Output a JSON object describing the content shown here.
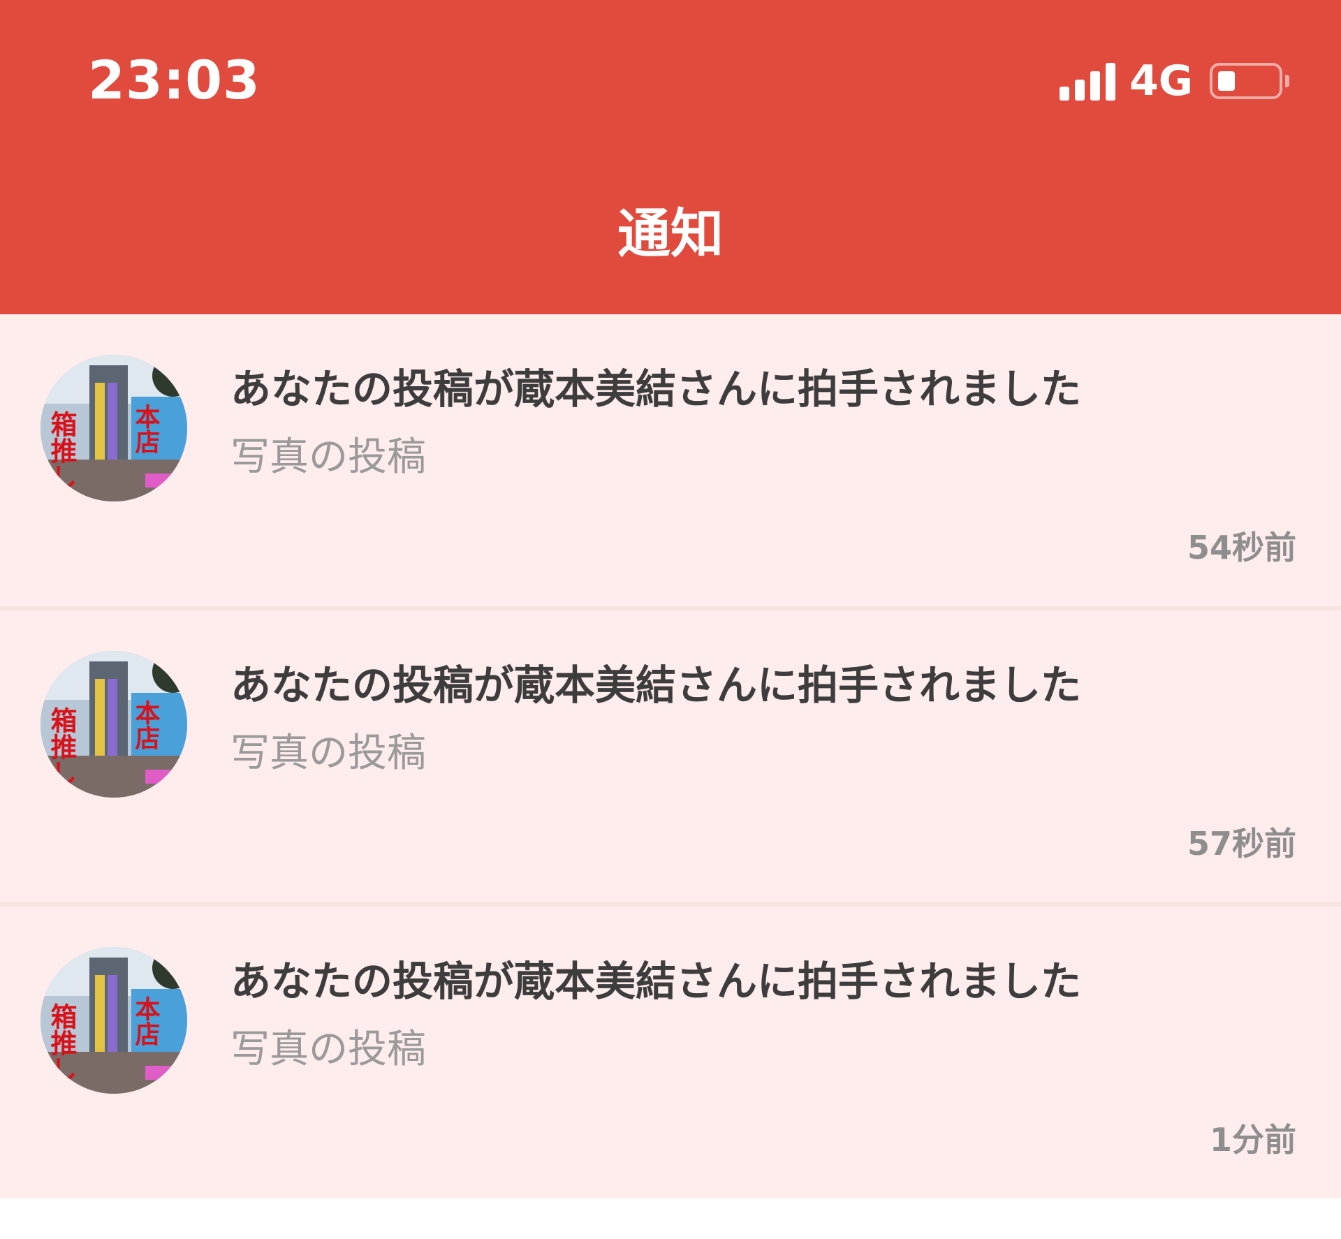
{
  "status_bar": {
    "time": "23:03",
    "network": "4G"
  },
  "nav": {
    "title": "通知"
  },
  "avatar_image": {
    "sign_left": "箱推し",
    "sign_right": "本店"
  },
  "notifications": [
    {
      "title": "あなたの投稿が蔵本美結さんに拍手されました",
      "subtitle": "写真の投稿",
      "time": "54秒前"
    },
    {
      "title": "あなたの投稿が蔵本美結さんに拍手されました",
      "subtitle": "写真の投稿",
      "time": "57秒前"
    },
    {
      "title": "あなたの投稿が蔵本美結さんに拍手されました",
      "subtitle": "写真の投稿",
      "time": "1分前"
    }
  ],
  "colors": {
    "header": "#E04B3E",
    "item_bg": "#FFECEC",
    "title_text": "#3d3d3d",
    "subtitle_text": "#9a9a9a",
    "time_text": "#8e8e8e"
  }
}
